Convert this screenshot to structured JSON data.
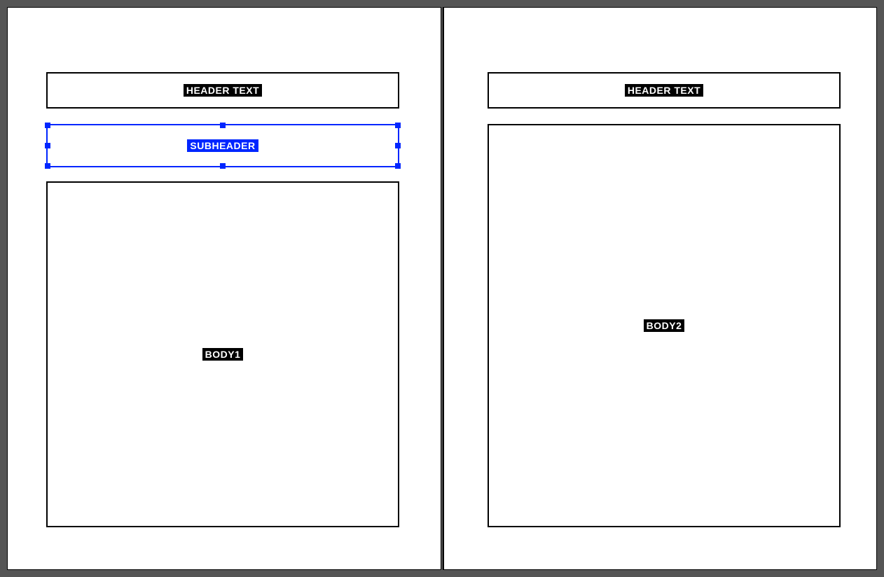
{
  "pages": {
    "left": {
      "frames": {
        "header": {
          "label": "HEADER TEXT",
          "selected": false
        },
        "subheader": {
          "label": "SUBHEADER",
          "selected": true
        },
        "body": {
          "label": "BODY1",
          "selected": false
        }
      }
    },
    "right": {
      "frames": {
        "header": {
          "label": "HEADER TEXT",
          "selected": false
        },
        "body": {
          "label": "BODY2",
          "selected": false
        }
      }
    }
  },
  "colors": {
    "canvas": "#555555",
    "page": "#ffffff",
    "frame": "#000000",
    "label_bg": "#000000",
    "label_fg": "#ffffff",
    "selection": "#0026ff"
  }
}
